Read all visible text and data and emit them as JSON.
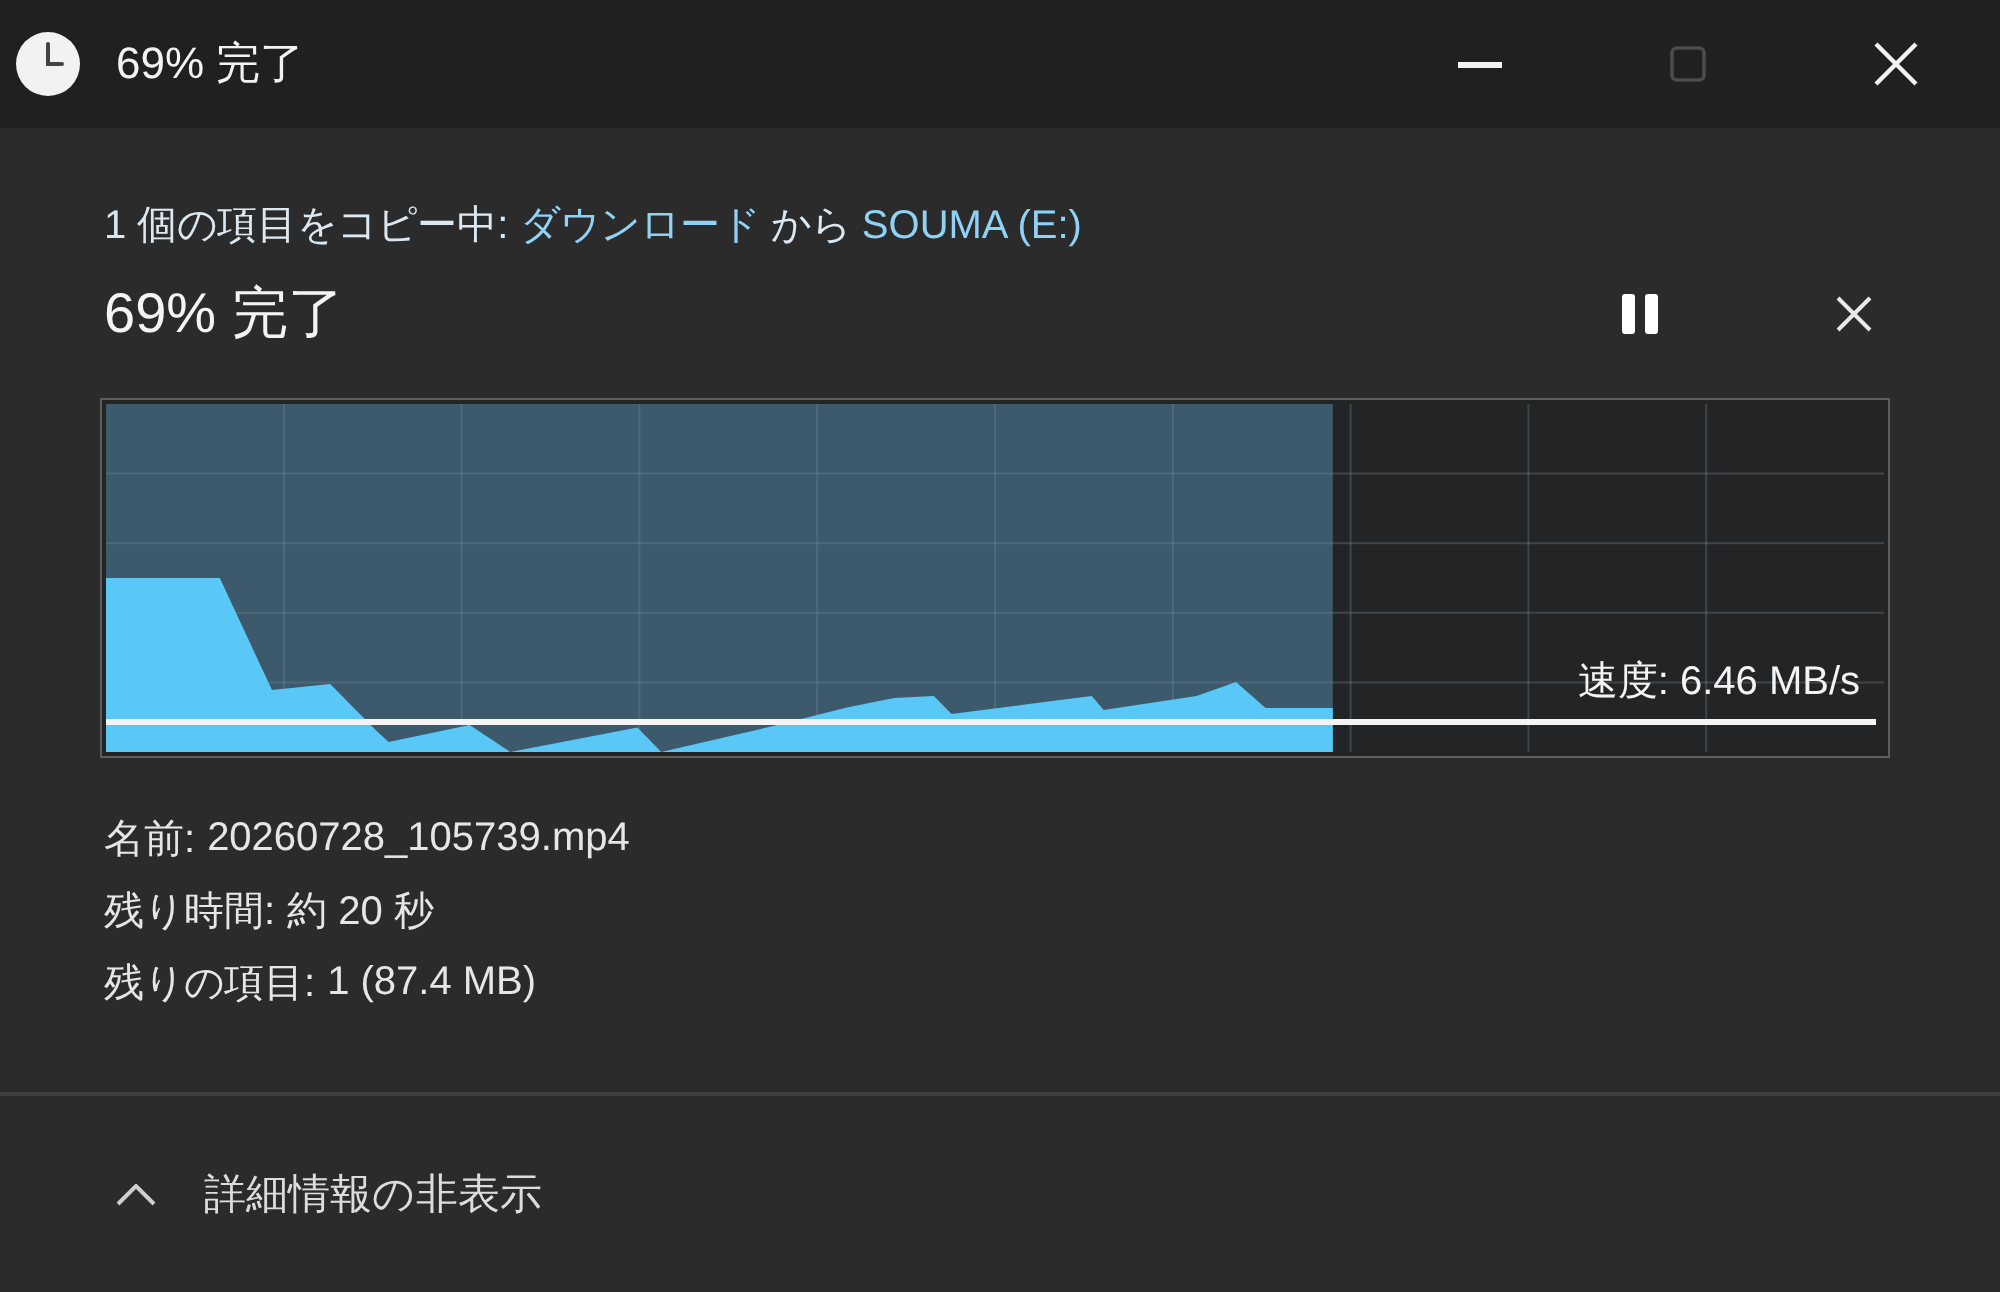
{
  "window": {
    "title": "69% 完了",
    "controls": [
      {
        "kind": "minimize",
        "disabled": false
      },
      {
        "kind": "maximize",
        "disabled": true
      },
      {
        "kind": "close",
        "disabled": false
      }
    ]
  },
  "status": {
    "parts": [
      {
        "kind": "text",
        "text": "1 個の項目をコピー中: "
      },
      {
        "kind": "link",
        "text": "ダウンロード"
      },
      {
        "kind": "text",
        "text": " から "
      },
      {
        "kind": "link",
        "text": "SOUMA (E:)"
      }
    ]
  },
  "progress": {
    "title": "69% 完了",
    "actions": [
      {
        "kind": "pause"
      },
      {
        "kind": "cancel"
      }
    ]
  },
  "graph": {
    "level": 0.69,
    "speed": "速度: 6.46 MB/s"
  },
  "details": [
    {
      "label": "名前:",
      "value": "20260728_105739.mp4"
    },
    {
      "label": "残り時間:",
      "value": "約 20 秒"
    },
    {
      "label": "残りの項目:",
      "value": "1 (87.4 MB)"
    }
  ],
  "footer": {
    "toggle": "詳細情報の非表示",
    "expanded": true
  }
}
